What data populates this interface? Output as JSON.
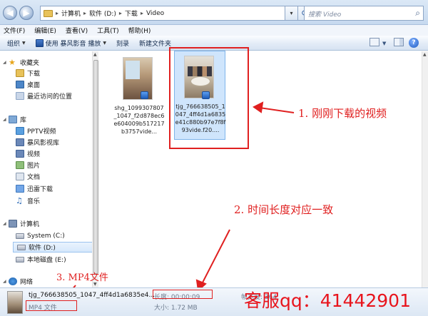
{
  "window": {
    "breadcrumbs": [
      "计算机",
      "软件 (D:)",
      "下载",
      "Video"
    ],
    "search_placeholder": "搜索 Video"
  },
  "menu": [
    "文件(F)",
    "编辑(E)",
    "查看(V)",
    "工具(T)",
    "帮助(H)"
  ],
  "commands": {
    "organize": "组织",
    "play_with": "使用 暴风影音 播放",
    "burn": "刻录",
    "new_folder": "新建文件夹"
  },
  "nav": {
    "favorites": "收藏夹",
    "favorites_items": [
      "下载",
      "桌面",
      "最近访问的位置"
    ],
    "libraries": "库",
    "libraries_items": [
      "PPTV视频",
      "暴风影视库",
      "视频",
      "图片",
      "文档",
      "迅雷下载",
      "音乐"
    ],
    "computer": "计算机",
    "computer_items": [
      "System (C:)",
      "软件 (D:)",
      "本地磁盘 (E:)"
    ],
    "network": "网络"
  },
  "files": [
    {
      "name": "shg_1099307807_1047_f2d878ec6e604009b517217b3757vide...",
      "selected": false
    },
    {
      "name": "tjg_766638505_1047_4ff4d1a6835e41c880b97e7f8f93vide.f20....",
      "selected": true
    }
  ],
  "annotations": {
    "a1": "1. 刚刚下载的视频",
    "a2": "2. 时间长度对应一致",
    "a3": "3. MP4文件"
  },
  "details": {
    "name": "tjg_766638505_1047_4ff4d1a6835e4...",
    "type": "MP4 文件",
    "duration": "长度: 00:00:09",
    "size": "大小: 1.72 MB",
    "extra": "帧宽度: 364"
  },
  "service": "客服qq：41442901",
  "colors": {
    "annotation": "#e02020",
    "selection": "#cfe5fc"
  }
}
